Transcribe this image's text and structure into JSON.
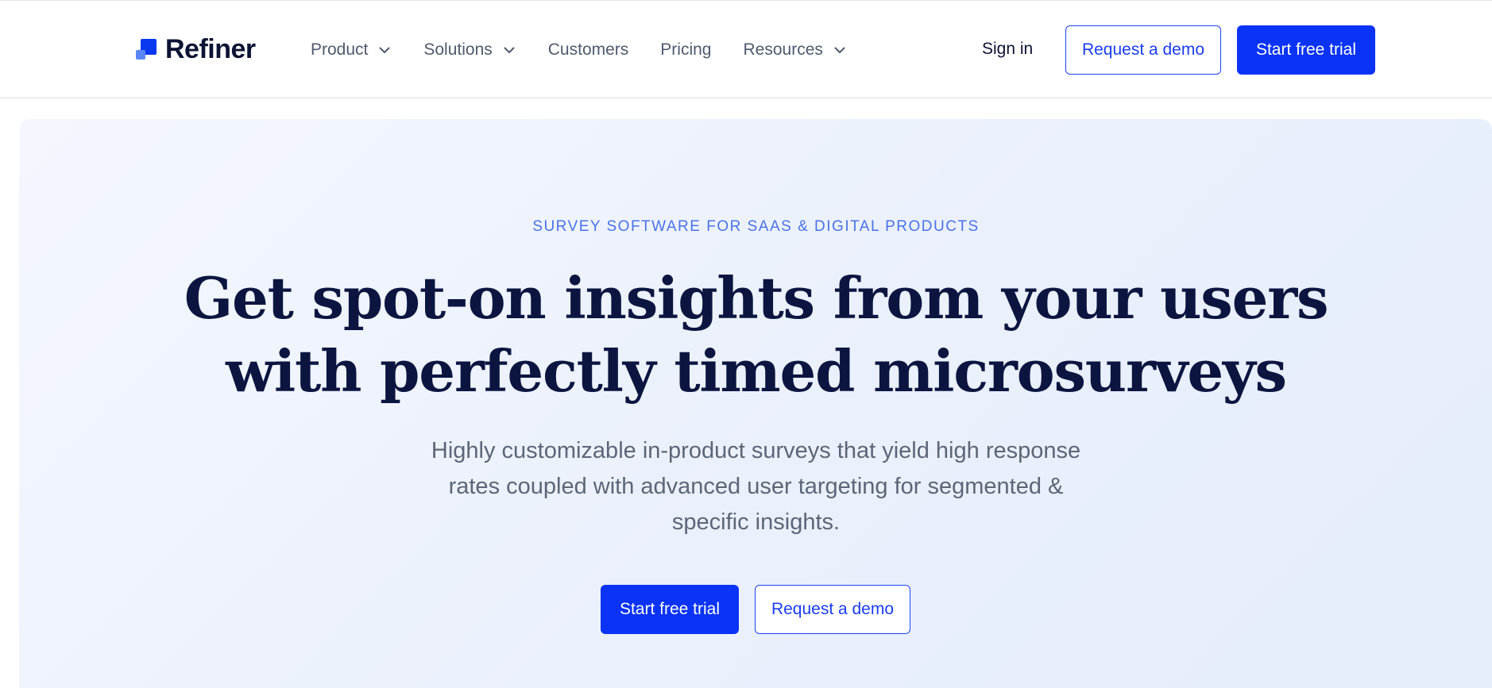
{
  "brand": {
    "name": "Refiner",
    "accent_color": "#0a33f5",
    "secondary_color": "#5b86f7"
  },
  "nav": {
    "items": [
      {
        "label": "Product",
        "has_dropdown": true
      },
      {
        "label": "Solutions",
        "has_dropdown": true
      },
      {
        "label": "Customers",
        "has_dropdown": false
      },
      {
        "label": "Pricing",
        "has_dropdown": false
      },
      {
        "label": "Resources",
        "has_dropdown": true
      }
    ],
    "dropdown_icon": "chevron-down-icon"
  },
  "header_actions": {
    "sign_in": "Sign in",
    "request_demo": "Request a demo",
    "start_trial": "Start free trial"
  },
  "hero": {
    "eyebrow": "SURVEY SOFTWARE FOR SAAS & DIGITAL PRODUCTS",
    "headline_line1": "Get spot-on insights from your users",
    "headline_line2": "with perfectly timed microsurveys",
    "subtext": "Highly customizable in-product surveys that yield high response rates coupled with advanced user targeting for segmented & specific insights.",
    "cta_primary": "Start free trial",
    "cta_secondary": "Request a demo"
  }
}
